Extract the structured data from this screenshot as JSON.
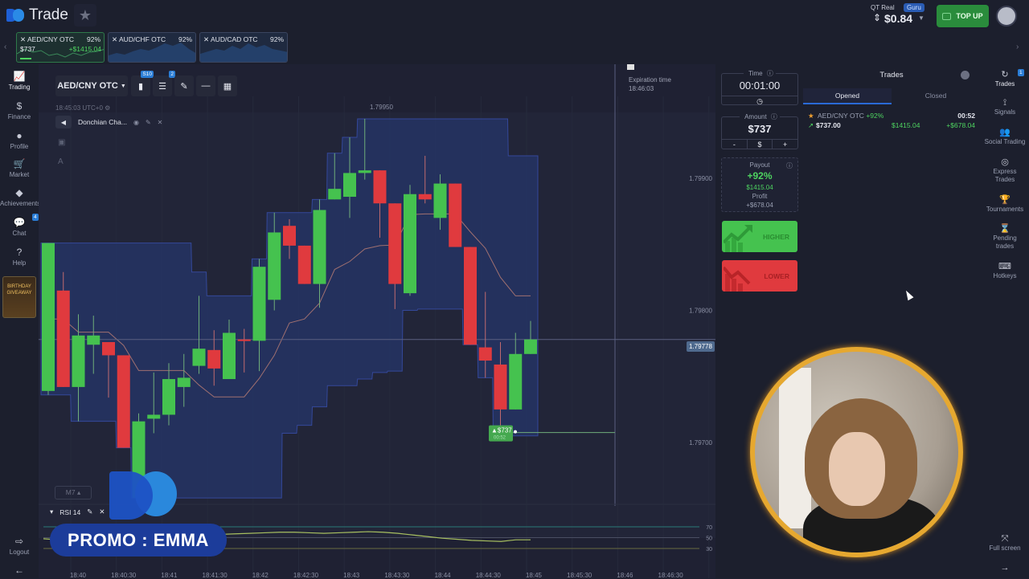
{
  "app": {
    "brand": "Trade"
  },
  "header": {
    "account_label": "QT Real",
    "account_badge": "Guru",
    "balance": "$0.84",
    "topup_label": "TOP UP"
  },
  "asset_tabs": [
    {
      "name": "AED/CNY OTC",
      "payout": "92%",
      "amount": "$737",
      "profit": "+$1415.04",
      "active": true
    },
    {
      "name": "AUD/CHF OTC",
      "payout": "92%",
      "active": false
    },
    {
      "name": "AUD/CAD OTC",
      "payout": "92%",
      "active": false
    }
  ],
  "left_nav": [
    {
      "label": "Trading",
      "icon": "chart-icon",
      "glyph": "📈",
      "active": true
    },
    {
      "label": "Finance",
      "icon": "dollar-icon",
      "glyph": "$"
    },
    {
      "label": "Profile",
      "icon": "user-icon",
      "glyph": "👤"
    },
    {
      "label": "Market",
      "icon": "cart-icon",
      "glyph": "🛒"
    },
    {
      "label": "Achievements",
      "icon": "diamond-icon",
      "glyph": "◆"
    },
    {
      "label": "Chat",
      "icon": "chat-icon",
      "glyph": "💬",
      "badge": "4"
    },
    {
      "label": "Help",
      "icon": "help-icon",
      "glyph": "?"
    }
  ],
  "promo_tile": {
    "line1": "BIRTHDAY",
    "line2": "GIVEAWAY"
  },
  "logout_label": "Logout",
  "chart": {
    "pair": "AED/CNY OTC",
    "indicators_badge": "S10",
    "settings_badge": "2",
    "server_time": "18:45:03 UTC+0",
    "indicator_name": "Donchian Cha...",
    "timeframe": "M7",
    "rsi_label": "RSI 14",
    "expiration_label": "Expiration time",
    "expiration_time": "18:46:03",
    "current_price": "1.79778",
    "high_label": "1.79950",
    "trade_marker_amount": "$737",
    "trade_marker_time": "00:52"
  },
  "chart_data": {
    "type": "candlestick",
    "title": "AED/CNY OTC",
    "ylim": [
      1.7968,
      1.79985
    ],
    "y_ticks": [
      "1.79900",
      "1.79800",
      "1.79700"
    ],
    "x_ticks": [
      "18:40",
      "18:40:30",
      "18:41",
      "18:41:30",
      "18:42",
      "18:42:30",
      "18:43",
      "18:43:30",
      "18:44",
      "18:44:30",
      "18:45",
      "18:45:30",
      "18:46",
      "18:46:30"
    ],
    "candles": [
      {
        "o": 1.79739,
        "h": 1.79851,
        "l": 1.79736,
        "c": 1.79851
      },
      {
        "o": 1.79815,
        "h": 1.79829,
        "l": 1.79742,
        "c": 1.79742
      },
      {
        "o": 1.79742,
        "h": 1.79797,
        "l": 1.79716,
        "c": 1.79781
      },
      {
        "o": 1.79774,
        "h": 1.79796,
        "l": 1.79752,
        "c": 1.79781
      },
      {
        "o": 1.79776,
        "h": 1.79776,
        "l": 1.79734,
        "c": 1.79766
      },
      {
        "o": 1.79766,
        "h": 1.79766,
        "l": 1.79696,
        "c": 1.79696
      },
      {
        "o": 1.79658,
        "h": 1.79722,
        "l": 1.79658,
        "c": 1.79716
      },
      {
        "o": 1.79718,
        "h": 1.79753,
        "l": 1.79707,
        "c": 1.79721
      },
      {
        "o": 1.79721,
        "h": 1.7976,
        "l": 1.79713,
        "c": 1.79748
      },
      {
        "o": 1.79742,
        "h": 1.79767,
        "l": 1.79727,
        "c": 1.79749
      },
      {
        "o": 1.79758,
        "h": 1.79811,
        "l": 1.79752,
        "c": 1.79771
      },
      {
        "o": 1.7977,
        "h": 1.79785,
        "l": 1.79743,
        "c": 1.79756
      },
      {
        "o": 1.79748,
        "h": 1.79793,
        "l": 1.79748,
        "c": 1.79783
      },
      {
        "o": 1.79778,
        "h": 1.79786,
        "l": 1.79753,
        "c": 1.79777
      },
      {
        "o": 1.79777,
        "h": 1.79839,
        "l": 1.79754,
        "c": 1.79833
      },
      {
        "o": 1.79808,
        "h": 1.79874,
        "l": 1.798,
        "c": 1.79859
      },
      {
        "o": 1.79864,
        "h": 1.79869,
        "l": 1.79839,
        "c": 1.79849
      },
      {
        "o": 1.79849,
        "h": 1.79849,
        "l": 1.7982,
        "c": 1.7982
      },
      {
        "o": 1.7982,
        "h": 1.79884,
        "l": 1.79802,
        "c": 1.79876
      },
      {
        "o": 1.79884,
        "h": 1.79919,
        "l": 1.79884,
        "c": 1.79892
      },
      {
        "o": 1.79886,
        "h": 1.79931,
        "l": 1.7987,
        "c": 1.79904
      },
      {
        "o": 1.79904,
        "h": 1.79945,
        "l": 1.79899,
        "c": 1.79906
      },
      {
        "o": 1.79906,
        "h": 1.79906,
        "l": 1.79855,
        "c": 1.79881
      },
      {
        "o": 1.79881,
        "h": 1.79881,
        "l": 1.79801,
        "c": 1.7982
      },
      {
        "o": 1.79813,
        "h": 1.79895,
        "l": 1.79811,
        "c": 1.79888
      },
      {
        "o": 1.79888,
        "h": 1.79917,
        "l": 1.79881,
        "c": 1.79884
      },
      {
        "o": 1.7987,
        "h": 1.79903,
        "l": 1.79861,
        "c": 1.79896
      },
      {
        "o": 1.79896,
        "h": 1.79896,
        "l": 1.79848,
        "c": 1.79848
      },
      {
        "o": 1.79848,
        "h": 1.79848,
        "l": 1.79774,
        "c": 1.79774
      },
      {
        "o": 1.79772,
        "h": 1.79814,
        "l": 1.79749,
        "c": 1.79762
      },
      {
        "o": 1.79759,
        "h": 1.79776,
        "l": 1.79705,
        "c": 1.79725
      },
      {
        "o": 1.79725,
        "h": 1.79783,
        "l": 1.79725,
        "c": 1.79767
      },
      {
        "o": 1.79767,
        "h": 1.79792,
        "l": 1.79767,
        "c": 1.79778
      }
    ],
    "rsi": {
      "name": "RSI 14",
      "levels": [
        70,
        50,
        30
      ],
      "values": [
        48,
        46,
        47,
        48,
        49,
        50,
        51,
        52,
        53,
        52,
        52,
        54,
        56,
        57,
        58,
        59,
        60,
        60,
        59,
        58,
        59,
        60,
        61,
        60,
        58,
        55,
        52,
        49,
        47,
        45,
        44,
        43,
        46,
        46
      ]
    }
  },
  "trade_panel": {
    "time_label": "Time",
    "time_value": "00:01:00",
    "amount_label": "Amount",
    "amount_value": "$737",
    "minus": "-",
    "currency": "$",
    "plus": "+",
    "payout_label": "Payout",
    "payout_percent": "+92%",
    "payout_amount": "$1415.04",
    "profit_label": "Profit",
    "profit_value": "+$678.04",
    "higher_label": "HIGHER",
    "lower_label": "LOWER"
  },
  "trades": {
    "title": "Trades",
    "tabs": [
      "Opened",
      "Closed"
    ],
    "items": [
      {
        "asset": "AED/CNY OTC",
        "payout": "+92%",
        "time_left": "00:52",
        "amount": "$737.00",
        "payout_amount": "$1415.04",
        "profit": "+$678.04"
      }
    ]
  },
  "right_nav": [
    {
      "label": "Trades",
      "glyph": "↻",
      "active": true,
      "badge": "1"
    },
    {
      "label": "Signals",
      "glyph": "📡"
    },
    {
      "label": "Social Trading",
      "glyph": "👥"
    },
    {
      "label": "Express Trades",
      "glyph": "◎"
    },
    {
      "label": "Tournaments",
      "glyph": "🏆"
    },
    {
      "label": "Pending trades",
      "glyph": "⌛"
    },
    {
      "label": "Hotkeys",
      "glyph": "⌨"
    }
  ],
  "fullscreen_label": "Full screen",
  "overlay": {
    "promo_text": "PROMO : EMMA"
  },
  "colors": {
    "up": "#45c24f",
    "down": "#e03a3e",
    "accent": "#2a7dd6",
    "channel": "#26356a"
  }
}
